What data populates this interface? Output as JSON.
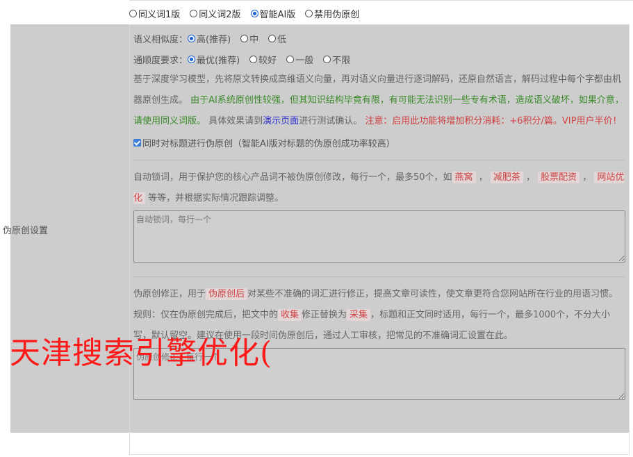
{
  "mode_options": [
    {
      "label": "同义词1版",
      "selected": false
    },
    {
      "label": "同义词2版",
      "selected": false
    },
    {
      "label": "智能AI版",
      "selected": true
    },
    {
      "label": "禁用伪原创",
      "selected": false
    }
  ],
  "section_label": "伪原创设置",
  "similarity": {
    "label": "语义相似度：",
    "options": [
      {
        "label": "高(推荐)",
        "selected": true
      },
      {
        "label": "中",
        "selected": false
      },
      {
        "label": "低",
        "selected": false
      }
    ]
  },
  "fluency": {
    "label": "通顺度要求：",
    "options": [
      {
        "label": "最优(推荐)",
        "selected": true
      },
      {
        "label": "较好",
        "selected": false
      },
      {
        "label": "一般",
        "selected": false
      },
      {
        "label": "不限",
        "selected": false
      }
    ]
  },
  "ai_desc": {
    "part1": "基于深度学习模型，先将原文转换成高维语义向量，再对语义向量进行逐词解码，还原自然语言，解码过程中每个字都由机器原创生成。",
    "part2_green": "由于AI系统原创性较强，但其知识结构毕竟有限，有可能无法识别一些专有术语，造成语义破坏，如果介意，请使用同义词版。",
    "part3": "具体效果请到",
    "link": "演示页面",
    "part4": "进行测试确认。",
    "part5_red": "注意：启用此功能将增加积分消耗：+6积分/篇。VIP用户半价！"
  },
  "title_checkbox": {
    "label": "同时对标题进行伪原创（智能AI版对标题的伪原创成功率较高）",
    "checked": true
  },
  "lock_words": {
    "desc_a": "自动锁词，用于保护您的核心产品词不被伪原创修改，每行一个，最多50个，如",
    "tags": [
      "燕窝",
      "减肥茶",
      "股票配资",
      "网站优化"
    ],
    "desc_b": "等等，并根据实际情况跟踪调整。",
    "placeholder": "自动锁词，每行一个"
  },
  "correction": {
    "desc_a": "伪原创修正，用于",
    "tag1": "伪原创后",
    "desc_b": "对某些不准确的词汇进行修正，提高文章可读性，使文章更符合您网站所在行业的用语习惯。规则：仅在伪原创完成后，把文中的",
    "tag2": "收集",
    "desc_c": "修正替换为",
    "tag3": "采集",
    "desc_d": "，标题和正文同时适用，每行一个，最多1000个，不分大小写，默认留空。建议在使用一段时间伪原创后，通过人工审核，把常见的不准确词汇设置在此。",
    "placeholder": "伪原创修正，每行一个"
  },
  "watermark": "天津搜索引擎优化("
}
